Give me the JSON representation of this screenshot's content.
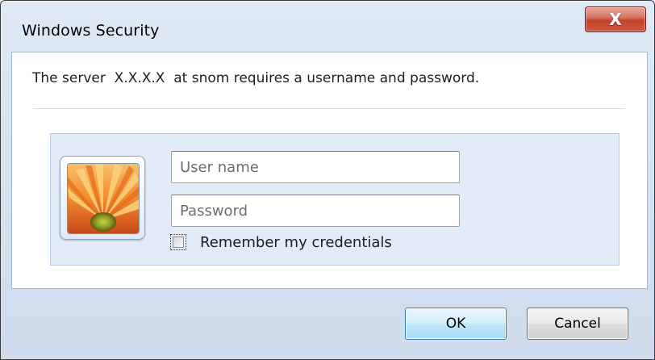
{
  "window": {
    "title": "Windows Security",
    "close_glyph": "X"
  },
  "message": {
    "text": "The server  X.X.X.X  at snom requires a username and password."
  },
  "credentials": {
    "avatar_icon": "flower-user-tile-icon",
    "username_placeholder": "User name",
    "username_value": "",
    "password_placeholder": "Password",
    "password_value": "",
    "remember_label": "Remember my credentials",
    "remember_checked": false
  },
  "buttons": {
    "ok_label": "OK",
    "cancel_label": "Cancel"
  },
  "colors": {
    "close_button": "#c4422b",
    "ok_button": "#bee6fd",
    "panel_background": "#e2ecf8",
    "frame": "#d6e3f1"
  }
}
